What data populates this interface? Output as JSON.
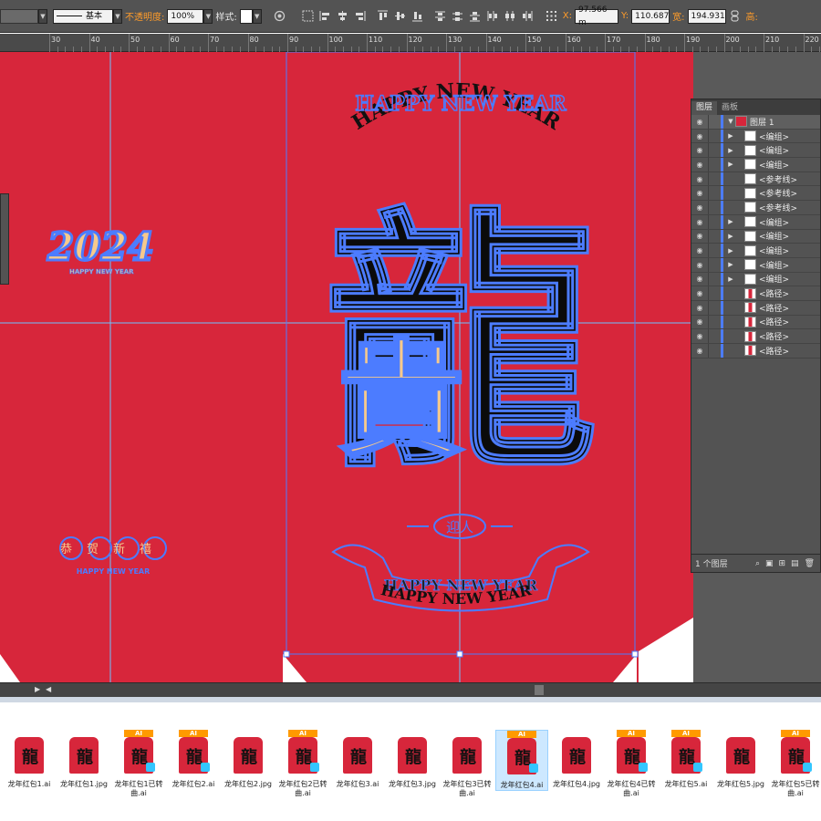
{
  "toolbar": {
    "stroke_style": "基本",
    "opacity_label": "不透明度:",
    "opacity_value": "100%",
    "style_label": "样式:",
    "x_label": "X:",
    "x_value": "97.566 m",
    "y_label": "Y:",
    "y_value": "110.687",
    "w_label": "宽:",
    "w_value": "194.931",
    "h_label": "高:"
  },
  "ruler": {
    "labels": [
      "30",
      "40",
      "50",
      "60",
      "70",
      "80",
      "90",
      "100",
      "110",
      "120",
      "130",
      "140",
      "150",
      "160",
      "170",
      "180",
      "190",
      "200",
      "210",
      "220"
    ]
  },
  "artwork": {
    "arc_text": "HAPPY NEW YEAR",
    "arc_text_2": "HAPPY NEW YEAR",
    "big_char": "龍",
    "year": "2024",
    "small_text": "HAPPY NEW YEAR",
    "greeting": "恭贺新禧",
    "greeting_sub": "HAPPY NEW YEAR",
    "bottom_badge": "迎人",
    "ribbon_text_1": "HAPPY NEW YEAR",
    "ribbon_text_2": "HAPPY NEW YEAR"
  },
  "layers_panel": {
    "tabs": [
      "图层",
      "画板"
    ],
    "layer_name": "图层 1",
    "rows": [
      {
        "name": "<编组>",
        "expandable": true
      },
      {
        "name": "<编组>",
        "expandable": true
      },
      {
        "name": "<编组>",
        "expandable": true
      },
      {
        "name": "<参考线>",
        "expandable": false
      },
      {
        "name": "<参考线>",
        "expandable": false
      },
      {
        "name": "<参考线>",
        "expandable": false
      },
      {
        "name": "<编组>",
        "expandable": true
      },
      {
        "name": "<编组>",
        "expandable": true
      },
      {
        "name": "<编组>",
        "expandable": true
      },
      {
        "name": "<编组>",
        "expandable": true
      },
      {
        "name": "<编组>",
        "expandable": true
      },
      {
        "name": "<路径>",
        "expandable": false
      },
      {
        "name": "<路径>",
        "expandable": false
      },
      {
        "name": "<路径>",
        "expandable": false
      },
      {
        "name": "<路径>",
        "expandable": false
      },
      {
        "name": "<路径>",
        "expandable": false
      }
    ],
    "footer": "1 个图层"
  },
  "files": [
    {
      "name": "龙年红包1.ai",
      "badge": "",
      "char": "龍"
    },
    {
      "name": "龙年红包1.jpg",
      "badge": "",
      "char": "龍"
    },
    {
      "name": "龙年红包1已转曲.ai",
      "badge": "AI",
      "char": "龍"
    },
    {
      "name": "龙年红包2.ai",
      "badge": "AI",
      "char": "龍"
    },
    {
      "name": "龙年红包2.jpg",
      "badge": "",
      "char": "龍"
    },
    {
      "name": "龙年红包2已转曲.ai",
      "badge": "AI",
      "char": "龍"
    },
    {
      "name": "龙年红包3.ai",
      "badge": "",
      "char": "龍"
    },
    {
      "name": "龙年红包3.jpg",
      "badge": "",
      "char": "龍"
    },
    {
      "name": "龙年红包3已转曲.ai",
      "badge": "",
      "char": "龍"
    },
    {
      "name": "龙年红包4.ai",
      "badge": "AI",
      "char": "龍"
    },
    {
      "name": "龙年红包4.jpg",
      "badge": "",
      "char": "龍"
    },
    {
      "name": "龙年红包4已转曲.ai",
      "badge": "AI",
      "char": "龍"
    },
    {
      "name": "龙年红包5.ai",
      "badge": "AI",
      "char": "龍"
    },
    {
      "name": "龙年红包5.jpg",
      "badge": "",
      "char": "龍"
    },
    {
      "name": "龙年红包5已转曲.ai",
      "badge": "AI",
      "char": "龍"
    }
  ],
  "selected_file_index": 9,
  "colors": {
    "canvas_red": "#d7263b",
    "selection_blue": "#4c7cff",
    "gold": "#f6c98c",
    "ink": "#0b0b0b"
  }
}
